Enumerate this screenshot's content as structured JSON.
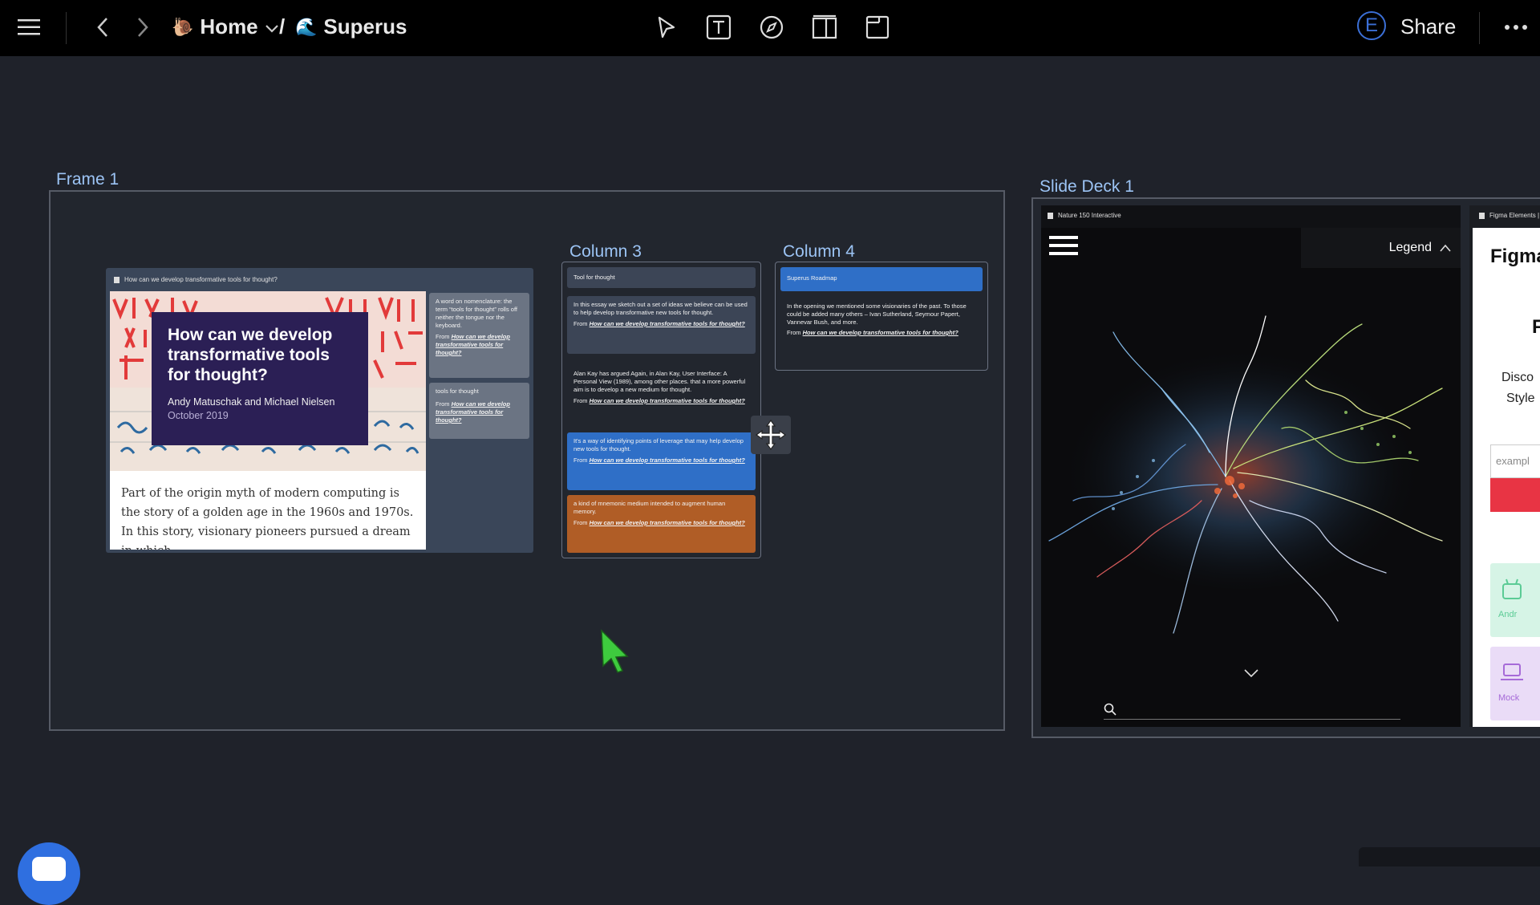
{
  "topbar": {
    "home_label": "Home",
    "separator": "/",
    "current_label": "Superus",
    "avatar_letter": "E",
    "share_label": "Share"
  },
  "frame1": {
    "label": "Frame 1",
    "article": {
      "tab_title": "How can we develop transformative tools for thought?",
      "heading": "How can we develop transformative tools for thought?",
      "authors": "Andy Matuschak and Michael Nielsen",
      "date": "October 2019",
      "body": "Part of the origin myth of modern computing is the story of a golden age in the 1960s and 1970s. In this story, visionary pioneers pursued a dream in which",
      "side_note_1_text": "A word on nomenclature: the term “tools for thought” rolls off neither the tongue nor the keyboard.",
      "side_note_1_from": "From",
      "side_note_1_link": "How can we develop transformative tools for thought?",
      "side_note_2_text": "tools for thought",
      "side_note_2_from": "From",
      "side_note_2_link": "How can we develop transformative tools for thought?"
    },
    "column3": {
      "label": "Column 3",
      "header": "Tool for thought",
      "note1_text": "In this essay we sketch out a set of ideas we believe can be used to help develop transformative new tools for thought.",
      "note2_text": "Alan Kay has argued Again, in Alan Kay, User Interface: A Personal View (1989), among other places. that a more powerful aim is to develop a new medium for thought.",
      "note3_text": "It's a way of identifying points of leverage that may help develop new tools for thought.",
      "note4_text": "a kind of mnemonic medium intended to augment human memory.",
      "from": "From",
      "link": "How can we develop transformative tools for thought?"
    },
    "column4": {
      "label": "Column 4",
      "header": "Superus Roadmap",
      "note_text": "In the opening we mentioned some visionaries of the past. To those could be added many others – Ivan Sutherland, Seymour Papert, Vannevar Bush, and more.",
      "from": "From",
      "link": "How can we develop transformative tools for thought?"
    }
  },
  "slidedeck": {
    "label": "Slide Deck 1",
    "tab1_title": "Nature 150 Interactive",
    "legend_label": "Legend",
    "tab2_title": "Figma Elements |",
    "figma_heading": "Figma",
    "figma_letter": "F",
    "figma_line1": "Disco",
    "figma_line2": "Style",
    "figma_input": "exampl",
    "android_label": "Andr",
    "mock_label": "Mock"
  },
  "colors": {
    "accent_blue": "#2f6fc7",
    "orange_note": "#b05d26",
    "grey_note": "#3c4556",
    "frame_label": "#9cc4f5"
  }
}
